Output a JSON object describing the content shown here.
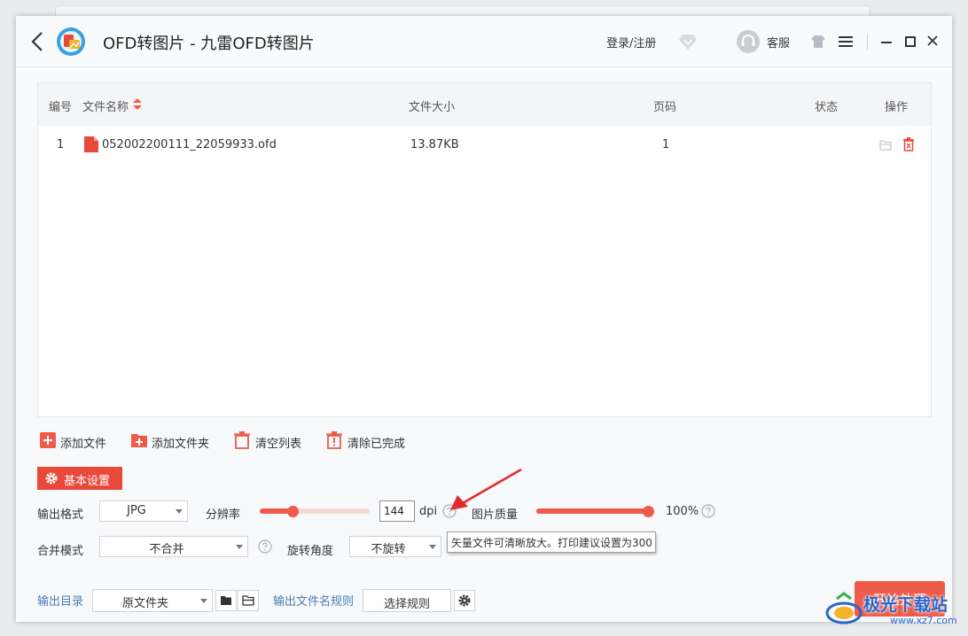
{
  "titlebar": {
    "title": "OFD转图片 - 九雷OFD转图片",
    "login_label": "登录/注册",
    "service_label": "客服",
    "icons": [
      "back-icon",
      "app-logo",
      "vip-icon",
      "service-icon",
      "skin-icon",
      "menu-icon",
      "minimize-icon",
      "maximize-icon",
      "close-icon"
    ]
  },
  "table": {
    "columns": {
      "index": "编号",
      "name": "文件名称",
      "size": "文件大小",
      "pages": "页码",
      "status": "状态",
      "actions": "操作"
    },
    "rows": [
      {
        "index": "1",
        "name": "052002200111_22059933.ofd",
        "size": "13.87KB",
        "pages": "1",
        "status": ""
      }
    ]
  },
  "toolbar": {
    "add_file": "添加文件",
    "add_folder": "添加文件夹",
    "clear_list": "清空列表",
    "clear_done": "清除已完成"
  },
  "settings": {
    "tab_label": "基本设置",
    "output_format_label": "输出格式",
    "output_format_value": "JPG",
    "resolution_label": "分辨率",
    "resolution_value": "144",
    "resolution_unit": "dpi",
    "resolution_slider_fraction": 0.3,
    "quality_label": "图片质量",
    "quality_value": "100%",
    "quality_fraction": 1.0,
    "merge_label": "合并模式",
    "merge_value": "不合并",
    "rotate_label": "旋转角度",
    "rotate_value": "不旋转",
    "tooltip": "矢量文件可清晰放大。打印建议设置为300"
  },
  "footer": {
    "output_dir_label": "输出目录",
    "output_dir_value": "原文件夹",
    "filename_rule_label": "输出文件名规则",
    "choose_rule_label": "选择规则",
    "start_label": "开始处理"
  },
  "watermark": {
    "text": "极光下载站",
    "sub": "www.xz7.com"
  },
  "colors": {
    "accent": "#ef5b4b",
    "accent_dark": "#e9493a",
    "link_blue": "#4a7bb0"
  }
}
